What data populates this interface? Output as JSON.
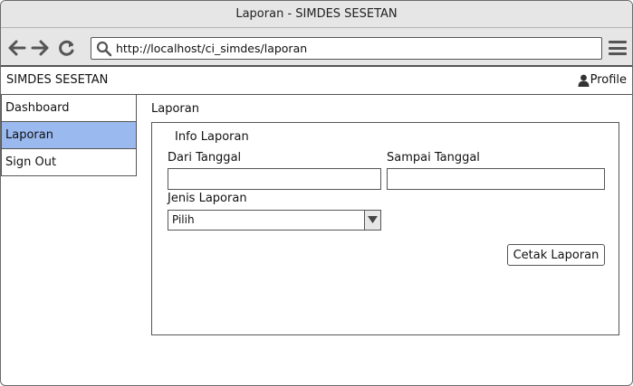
{
  "window": {
    "title": "Laporan - SIMDES SESETAN"
  },
  "browser": {
    "url": "http://localhost/ci_simdes/laporan",
    "icons": [
      "arrow-left-icon",
      "arrow-right-icon",
      "reload-icon",
      "search-icon",
      "hamburger-menu-icon"
    ]
  },
  "header": {
    "brand": "SIMDES SESETAN",
    "profile_label": "Profile",
    "profile_icon": "user-icon"
  },
  "sidebar": {
    "items": [
      {
        "label": "Dashboard",
        "active": false
      },
      {
        "label": "Laporan",
        "active": true
      },
      {
        "label": "Sign Out",
        "active": false
      }
    ],
    "active_color": "#9ab9ee"
  },
  "main": {
    "page_title": "Laporan",
    "panel_title": "Info Laporan",
    "dari_tanggal_label": "Dari Tanggal",
    "dari_tanggal_value": "",
    "sampai_tanggal_label": "Sampai Tanggal",
    "sampai_tanggal_value": "",
    "jenis_laporan_label": "Jenis Laporan",
    "jenis_laporan_selected": "Pilih",
    "cetak_button": "Cetak Laporan"
  }
}
